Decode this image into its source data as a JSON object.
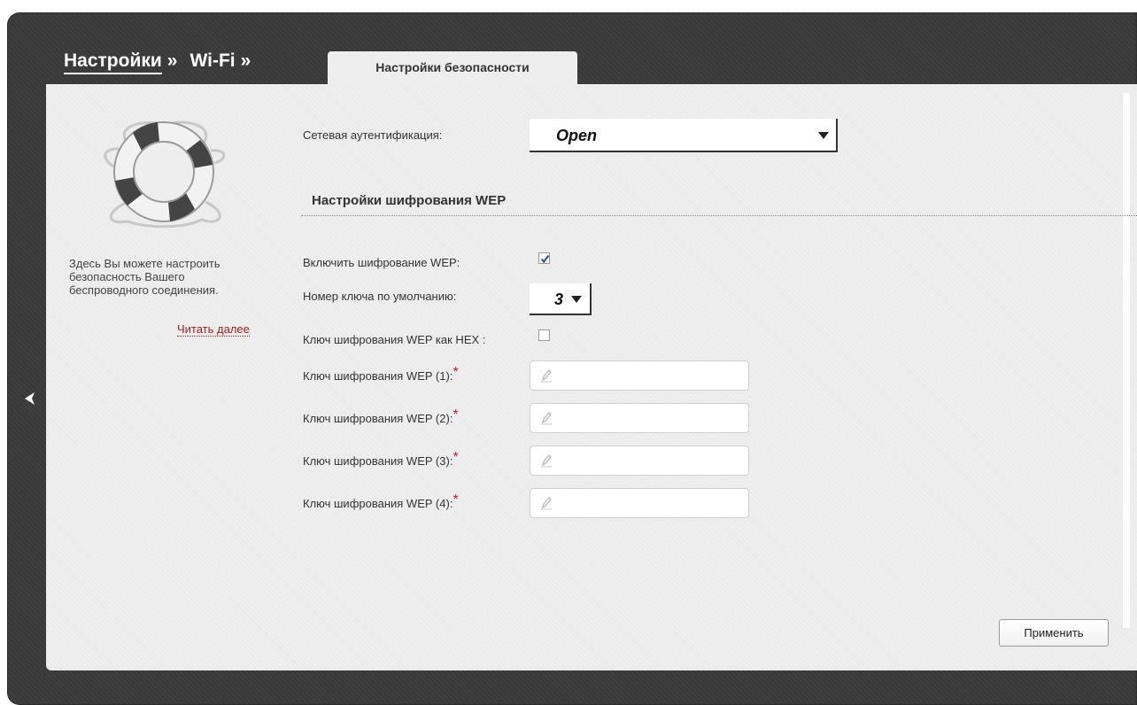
{
  "breadcrumb": {
    "settings": "Настройки",
    "sep": "»",
    "wifi": "Wi-Fi",
    "tab": "Настройки безопасности"
  },
  "help": {
    "text": "Здесь Вы можете настроить безопасность Вашего беспроводного соединения.",
    "more": "Читать далее"
  },
  "form": {
    "auth_label": "Сетевая аутентификация:",
    "auth_value": "Open",
    "wep_section_title": "Настройки шифрования WEP",
    "enable_wep_label": "Включить шифрование WEP:",
    "enable_wep_checked": true,
    "default_key_label": "Номер ключа по умолчанию:",
    "default_key_value": "3",
    "hex_label": "Ключ шифрования WEP как HEX :",
    "hex_checked": false,
    "required_mark": "*",
    "keys": [
      {
        "label": "Ключ шифрования WEP (1):",
        "value": ""
      },
      {
        "label": "Ключ шифрования WEP (2):",
        "value": ""
      },
      {
        "label": "Ключ шифрования WEP (3):",
        "value": ""
      },
      {
        "label": "Ключ шифрования WEP (4):",
        "value": ""
      }
    ]
  },
  "actions": {
    "apply": "Применить"
  },
  "icons": {
    "back": "chevron-left-icon",
    "logo": "lifebuoy-icon",
    "edit": "pencil-icon"
  },
  "colors": {
    "frame": "#3a3a3a",
    "panel": "#eeeeee",
    "link": "#a02020",
    "required": "#cc2222"
  }
}
